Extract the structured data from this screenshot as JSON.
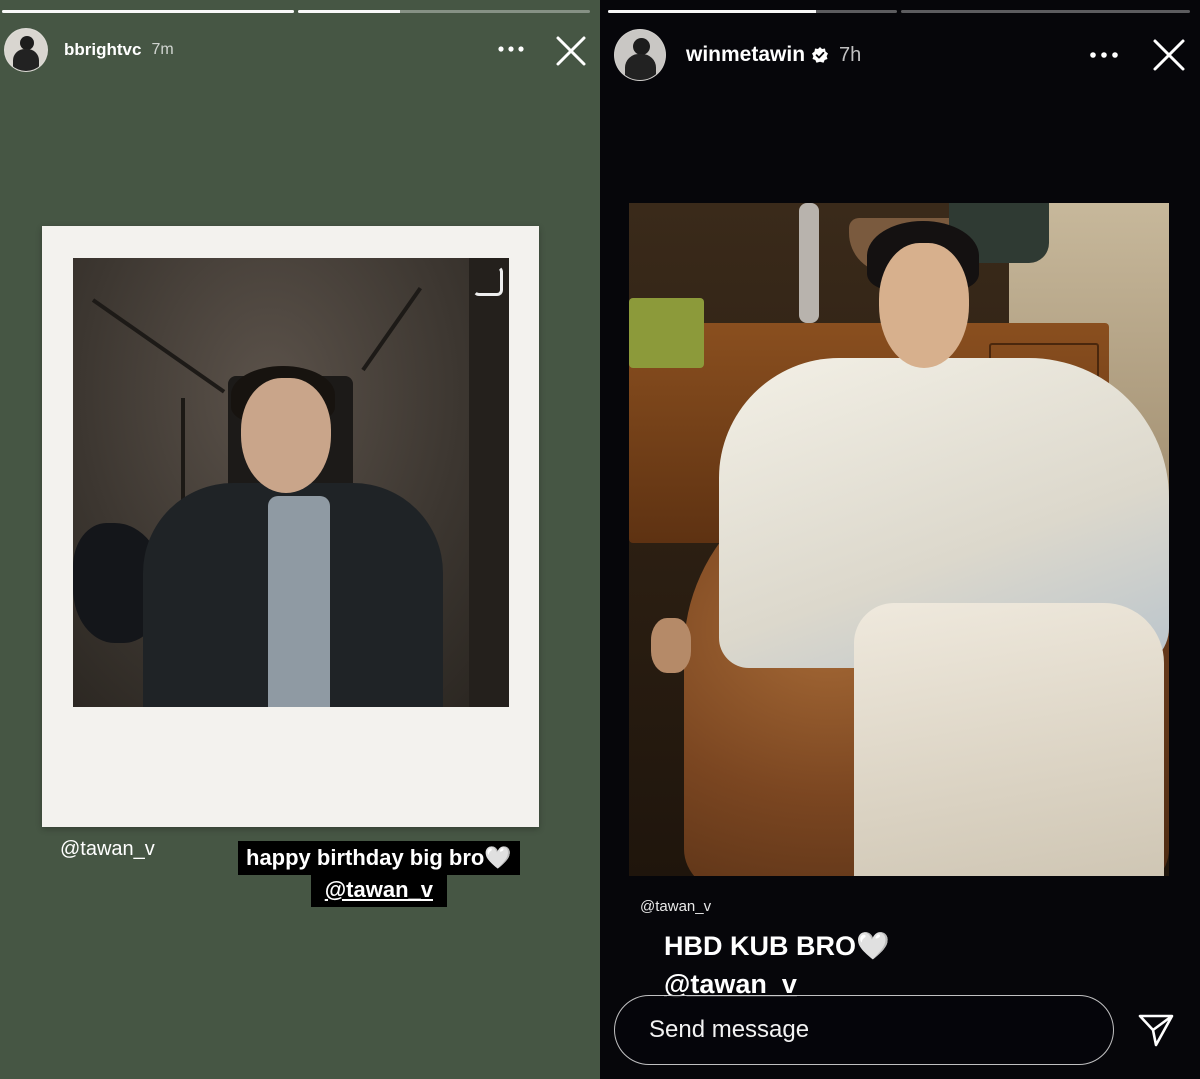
{
  "stories": {
    "left": {
      "progress": [
        1.0,
        0.35
      ],
      "username": "bbrightvc",
      "time": "7m",
      "background": "#465644",
      "mention_tag": "@tawan_v",
      "caption": {
        "line1": "happy birthday big bro🤍",
        "line2": "@tawan_v"
      },
      "icons": {
        "more": "more-icon",
        "close": "close-icon"
      }
    },
    "right": {
      "progress": [
        0.72,
        0.0
      ],
      "username": "winmetawin",
      "verified": true,
      "time": "7h",
      "background": "#06060a",
      "mention_tag": "@tawan_v",
      "caption": {
        "line1": "HBD KUB BRO🤍",
        "line2": "@tawan_v"
      },
      "message": {
        "placeholder": "Send message"
      },
      "icons": {
        "more": "more-icon",
        "close": "close-icon",
        "send": "send-icon",
        "verified": "verified-badge-icon"
      }
    }
  }
}
